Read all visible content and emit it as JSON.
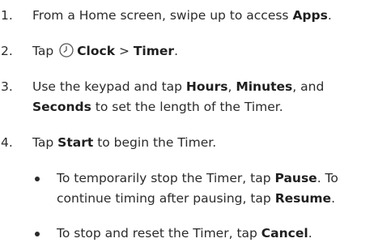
{
  "steps": [
    {
      "number": "1.",
      "text_pre": "From a Home screen, swipe up to access ",
      "bold": "Apps",
      "text_post": "."
    },
    {
      "number": "2.",
      "text_pre": "Tap ",
      "icon": "clock-app-icon",
      "bold_clock": "Clock",
      "sep": " > ",
      "bold_timer": "Timer",
      "text_post": "."
    },
    {
      "number": "3.",
      "line1_pre": "Use the keypad and tap ",
      "bold_hours": "Hours",
      "comma1": ", ",
      "bold_minutes": "Minutes",
      "and": ", and",
      "bold_seconds": "Seconds",
      "line2_post": " to set the length of the Timer."
    },
    {
      "number": "4.",
      "text_pre": "Tap ",
      "bold": "Start",
      "text_post": " to begin the Timer."
    }
  ],
  "bullets": [
    {
      "line1_pre": "To temporarily stop the Timer, tap ",
      "bold_pause": "Pause",
      "line1_post": ". To",
      "line2_pre": "continue timing after pausing, tap ",
      "bold_resume": "Resume",
      "line2_post": "."
    },
    {
      "pre": "To stop and reset the Timer, tap ",
      "bold": "Cancel",
      "post": "."
    }
  ]
}
